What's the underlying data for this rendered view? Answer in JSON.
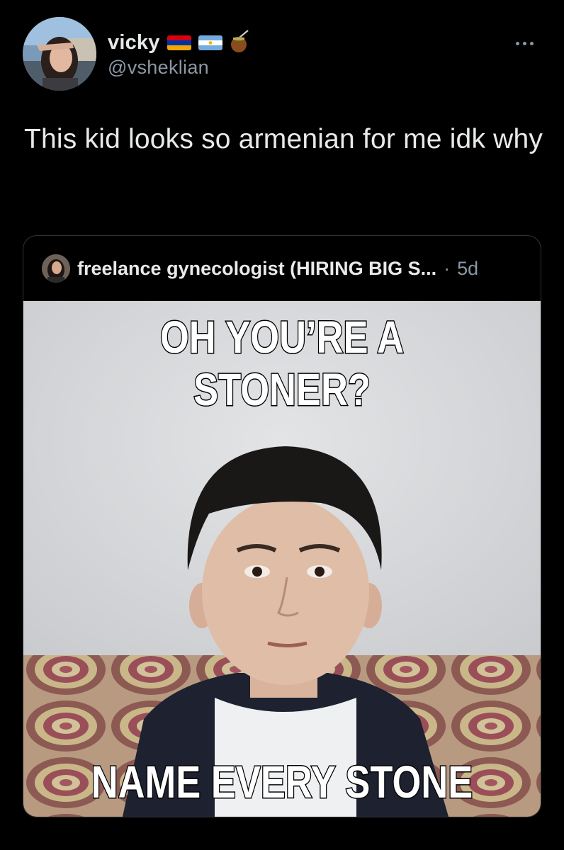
{
  "author": {
    "display_name": "vicky",
    "handle": "@vsheklian",
    "flags": [
      "armenia-flag-icon",
      "argentina-flag-icon"
    ],
    "extra_icon": "mate-cup-icon",
    "more_icon": "more-horizontal-icon"
  },
  "tweet": {
    "text": "This kid looks so armenian for me idk why"
  },
  "quoted_tweet": {
    "display_name": "freelance gynecologist (HIRING BIG S...",
    "separator": "·",
    "time": "5d",
    "meme": {
      "top_text": "OH YOU’RE A STONER?",
      "bottom_text": "NAME EVERY STONE"
    }
  },
  "colors": {
    "background": "#000000",
    "primary_text": "#e7e9ea",
    "secondary_text": "#8b98a5",
    "card_border": "#2f3336"
  }
}
